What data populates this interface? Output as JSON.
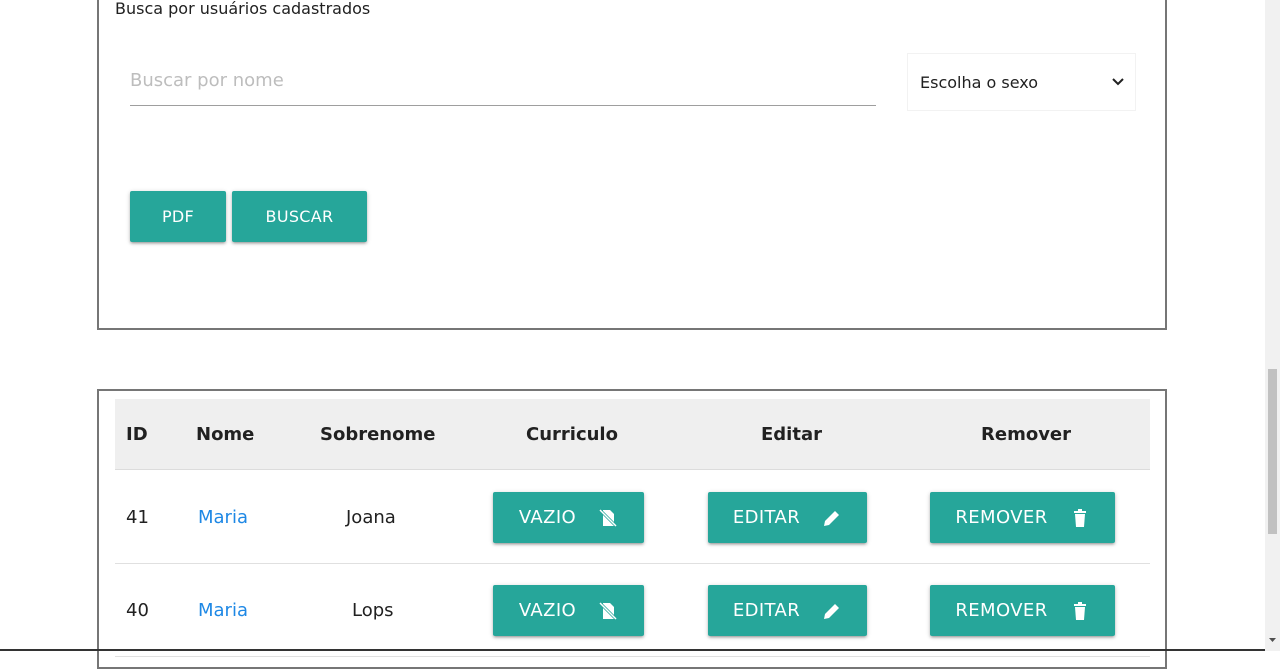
{
  "search": {
    "legend": "Busca por usuários cadastrados",
    "name_placeholder": "Buscar por nome",
    "gender_select": "Escolha o sexo",
    "pdf_label": "PDF",
    "buscar_label": "BUSCAR"
  },
  "table": {
    "headers": [
      "ID",
      "Nome",
      "Sobrenome",
      "Curriculo",
      "Editar",
      "Remover"
    ],
    "rows": [
      {
        "id": "41",
        "nome": "Maria",
        "sobrenome": "Joana",
        "curriculo": "VAZIO",
        "editar": "EDITAR",
        "remover": "REMOVER"
      },
      {
        "id": "40",
        "nome": "Maria",
        "sobrenome": "Lops",
        "curriculo": "VAZIO",
        "editar": "EDITAR",
        "remover": "REMOVER"
      }
    ]
  },
  "icons": {
    "curriculo": "no-file-icon",
    "editar": "pencil-icon",
    "remover": "trash-icon",
    "select": "chevron-down-icon"
  },
  "colors": {
    "accent": "#26a69a",
    "link": "#1e88e5",
    "header_bg": "#efefef"
  }
}
